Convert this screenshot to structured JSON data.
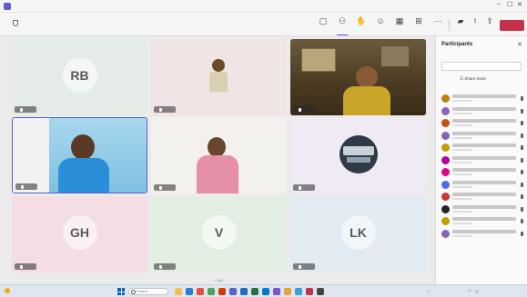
{
  "window": {
    "title": "",
    "controls": [
      "–",
      "☐",
      "✕"
    ]
  },
  "toolbar": {
    "timer": "",
    "buttons": [
      {
        "icon": "chat-icon",
        "glyph": "▢",
        "label": ""
      },
      {
        "icon": "people-icon",
        "glyph": "⚇",
        "label": "",
        "badge": "",
        "active": true
      },
      {
        "icon": "raise-hand-icon",
        "glyph": "✋",
        "label": ""
      },
      {
        "icon": "react-icon",
        "glyph": "☺",
        "label": ""
      },
      {
        "icon": "view-icon",
        "glyph": "▦",
        "label": ""
      },
      {
        "icon": "apps-icon",
        "glyph": "⊞",
        "label": ""
      },
      {
        "icon": "more-icon",
        "glyph": "···",
        "label": ""
      },
      {
        "icon": "camera-icon",
        "glyph": "▰",
        "label": ""
      },
      {
        "icon": "mic-icon",
        "glyph": "♮",
        "label": ""
      },
      {
        "icon": "share-icon",
        "glyph": "⇪",
        "label": ""
      }
    ],
    "leave_label": ""
  },
  "stage": {
    "tiles": [
      {
        "initials": "RB",
        "name": "",
        "bg": "#e6ede9",
        "type": "avatar"
      },
      {
        "initials": "",
        "name": "",
        "bg": "#f1e4e4",
        "type": "photo"
      },
      {
        "initials": "",
        "name": "",
        "bg": "#5a4a30",
        "type": "video"
      },
      {
        "initials": "",
        "name": "",
        "bg": "#9bd0e8",
        "type": "video"
      },
      {
        "initials": "",
        "name": "",
        "bg": "#f3f1ee",
        "type": "video"
      },
      {
        "initials": "",
        "name": "",
        "bg": "#efeaf3",
        "type": "photo"
      },
      {
        "initials": "GH",
        "name": "",
        "bg": "#f4dde5",
        "type": "avatar"
      },
      {
        "initials": "V",
        "name": "",
        "bg": "#e4efe3",
        "type": "avatar"
      },
      {
        "initials": "LK",
        "name": "",
        "bg": "#e3ebf2",
        "type": "avatar"
      }
    ],
    "pager": "‹  1/4  ›"
  },
  "panel": {
    "title": "Participants",
    "invite_placeholder": "",
    "share_invite": "Share invite",
    "in_meeting_label": "",
    "others_label": "",
    "participants": [
      {
        "initials": "",
        "color": "#c27c0e"
      },
      {
        "initials": "",
        "color": "#8764b8"
      },
      {
        "initials": "",
        "color": "#ca5010"
      },
      {
        "initials": "",
        "color": "#8764b8"
      },
      {
        "initials": "",
        "color": "#c19c00"
      },
      {
        "initials": "",
        "color": "#b4009e"
      },
      {
        "initials": "",
        "color": "#e3008c"
      },
      {
        "initials": "",
        "color": "#4f6bed"
      },
      {
        "initials": "",
        "color": "#d13438"
      },
      {
        "initials": "",
        "color": "#242424"
      },
      {
        "initials": "",
        "color": "#c19c00"
      },
      {
        "initials": "",
        "color": "#8764b8"
      }
    ]
  },
  "taskbar": {
    "weather": "",
    "search_placeholder": "Search",
    "language": "",
    "time": "",
    "date": ""
  },
  "colors": {
    "accent": "#5b5fc7",
    "leave": "#c4314b"
  }
}
